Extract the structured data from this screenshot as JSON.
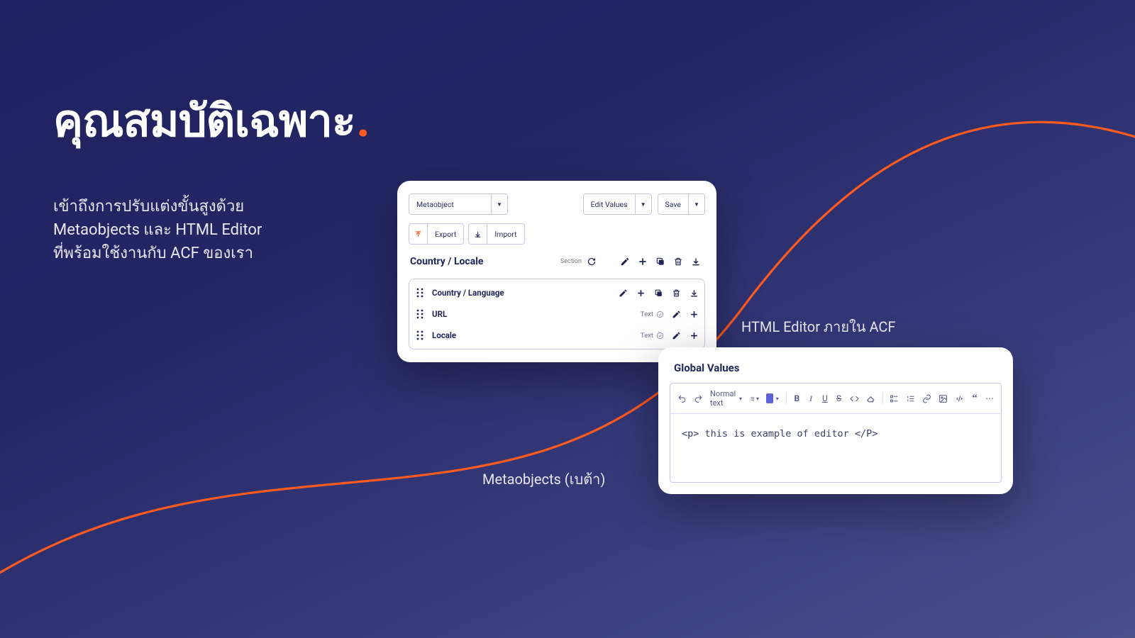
{
  "title": "คุณสมบัติเฉพาะ",
  "title_dot": ".",
  "description_l1": "เข้าถึงการปรับแต่งขั้นสูงด้วย",
  "description_l2": "Metaobjects และ HTML Editor",
  "description_l3": "ที่พร้อมใช้งานกับ ACF ของเรา",
  "meta_card": {
    "selector": "Metaobject",
    "edit_values": "Edit Values",
    "save": "Save",
    "export": "Export",
    "import": "Import",
    "section_title": "Country / Locale",
    "section_sub": "Section",
    "fields": [
      {
        "name": "Country / Language",
        "type": "",
        "full_actions": true
      },
      {
        "name": "URL",
        "type": "Text",
        "full_actions": false
      },
      {
        "name": "Locale",
        "type": "Text",
        "full_actions": false
      }
    ]
  },
  "caption_meta": "Metaobjects (เบต้า)",
  "caption_editor": "HTML Editor ภายใน ACF",
  "editor_card": {
    "title": "Global Values",
    "format_label": "Normal text",
    "body": "<p> this is example of editor </P>"
  },
  "colors": {
    "accent": "#ff5a1f",
    "brand_dark": "#22255a",
    "swatch": "#5d63d6"
  }
}
